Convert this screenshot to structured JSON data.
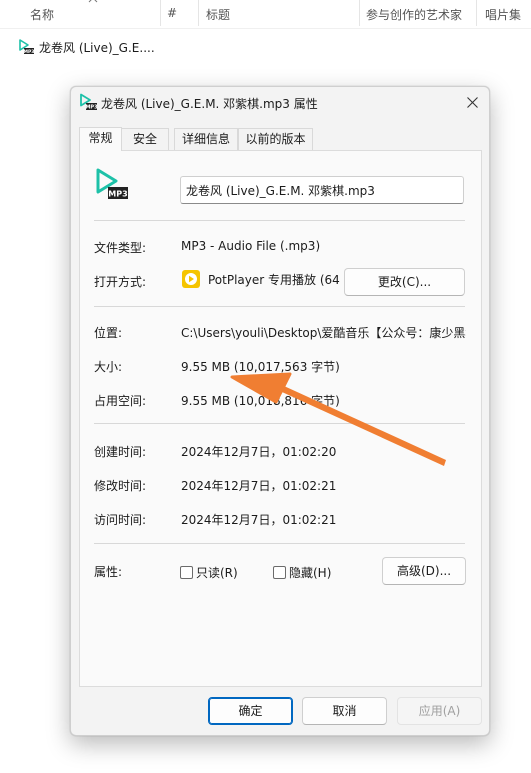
{
  "explorer": {
    "columns": [
      "名称",
      "#",
      "标题",
      "参与创作的艺术家",
      "唱片集"
    ],
    "file_name": "龙卷风 (Live)_G.E...."
  },
  "dialog": {
    "title": "龙卷风 (Live)_G.E.M. 邓紫棋.mp3 属性",
    "tabs": [
      "常规",
      "安全",
      "详细信息",
      "以前的版本"
    ],
    "active_tab": "常规",
    "file_name_value": "龙卷风 (Live)_G.E.M. 邓紫棋.mp3",
    "icon_badge": "MP3",
    "fields": {
      "file_type_label": "文件类型:",
      "file_type_value": "MP3 - Audio File (.mp3)",
      "open_with_label": "打开方式:",
      "open_with_value": "PotPlayer 专用播放 (64",
      "change_button": "更改(C)...",
      "location_label": "位置:",
      "location_value": "C:\\Users\\youli\\Desktop\\爱酷音乐【公众号：康少黑科",
      "size_label": "大小:",
      "size_value": "9.55 MB (10,017,563 字节)",
      "size_on_disk_label": "占用空间:",
      "size_on_disk_value": "9.55 MB (10,018,816 字节)",
      "created_label": "创建时间:",
      "created_value": "2024年12月7日，01:02:20",
      "modified_label": "修改时间:",
      "modified_value": "2024年12月7日，01:02:21",
      "accessed_label": "访问时间:",
      "accessed_value": "2024年12月7日，01:02:21",
      "attributes_label": "属性:",
      "readonly_label": "只读(R)",
      "hidden_label": "隐藏(H)",
      "advanced_button": "高级(D)..."
    },
    "buttons": {
      "ok": "确定",
      "cancel": "取消",
      "apply": "应用(A)"
    }
  },
  "colors": {
    "accent": "#0067c0",
    "mp3_icon": "#1dc1a8",
    "potplayer": "#f5c400",
    "annotation_arrow": "#f07e32"
  }
}
